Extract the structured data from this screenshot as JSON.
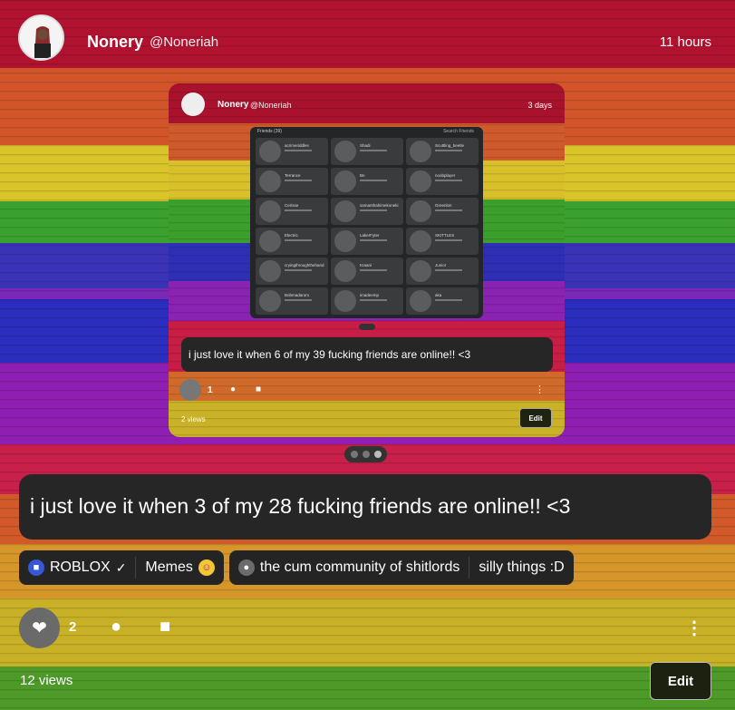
{
  "post": {
    "display_name": "Nonery",
    "handle": "@Noneriah",
    "time": "11 hours",
    "text": "i just love it when 3 of my 28 fucking friends are online!! <3",
    "likes": "2",
    "views": "12 views",
    "edit_label": "Edit"
  },
  "embed": {
    "display_name": "Nonery",
    "handle": "@Noneriah",
    "time": "3 days",
    "text": "i just love it when 6 of my 39 fucking friends are online!! <3",
    "likes": "1",
    "views": "2 views",
    "edit_label": "Edit",
    "friends_header": "Friends (39)",
    "search_placeholder": "Search Friends",
    "friends": [
      {
        "name": "acrimeriddles"
      },
      {
        "name": "Shadi"
      },
      {
        "name": "Scuttling_beetle"
      },
      {
        "name": "Terrance"
      },
      {
        "name": "Bn"
      },
      {
        "name": "noobplayer"
      },
      {
        "name": "Cerisse"
      },
      {
        "name": "samanthahimekoneki"
      },
      {
        "name": "Greenlon"
      },
      {
        "name": "Electric"
      },
      {
        "name": "LakerFyter"
      },
      {
        "name": "SKITTLES"
      },
      {
        "name": "cryingthroughthehand"
      },
      {
        "name": "Kraani"
      },
      {
        "name": "Junior"
      },
      {
        "name": "Bobmadarom"
      },
      {
        "name": "imadeemp"
      },
      {
        "name": "aka"
      }
    ]
  },
  "tags": [
    {
      "label": "ROBLOX",
      "icon": "roblox-icon",
      "color": "#3557d8"
    },
    {
      "label": "Memes",
      "icon": "silly-face-emoji"
    },
    {
      "label": "the cum community of shitlords",
      "icon": "community-icon"
    },
    {
      "label": "silly things :D"
    }
  ],
  "colors": {
    "bubble": "#262626",
    "edit_button": "#1d210f"
  }
}
